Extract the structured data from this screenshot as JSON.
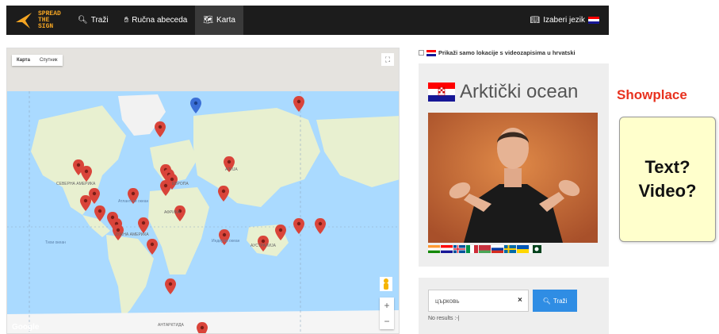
{
  "navbar": {
    "logo_text": [
      "SPREAD",
      "THE",
      "SIGN"
    ],
    "items": [
      {
        "label": "Traži",
        "icon": "search-icon"
      },
      {
        "label": "Ručna abeceda",
        "icon": "hand-icon"
      },
      {
        "label": "Karta",
        "icon": "map-icon",
        "active": true
      }
    ],
    "language": {
      "label": "Izaberi jezik",
      "icon": "book-icon"
    }
  },
  "map": {
    "type_options": [
      "Карта",
      "Спутник"
    ],
    "selected_type": "Карта",
    "region_labels": [
      "СЕВЕРНА АМЕРИКА",
      "АЗИЈА",
      "ЕВРОПА",
      "АФРИКА",
      "ЈУЖНА АМЕРИКА",
      "АУСТРАЛИЈА",
      "АНТАРКТИДА",
      "Tихи океан",
      "Индијски океан",
      "Атлантски океан"
    ],
    "google_label": "Google",
    "zoom_in": "+",
    "zoom_out": "−"
  },
  "filter": {
    "label": "Prikaži samo lokacije s videozapisima u hrvatski"
  },
  "location": {
    "title": "Arktički ocean",
    "flag": "croatia"
  },
  "language_flags": [
    "india",
    "croatia",
    "iceland",
    "italy",
    "belarus",
    "russia",
    "sweden",
    "ukraine",
    "pakistan"
  ],
  "search": {
    "value": "църковь",
    "button_label": "Traži",
    "clear_icon": "×",
    "results_text": "No results :-|"
  },
  "annotation": {
    "heading": "Showplace",
    "card_text": "Text?\nVideo?"
  },
  "colors": {
    "navbar": "#1c1c1c",
    "accent_orange": "#f5a623",
    "ocean": "#aadaff",
    "land": "#e8f0d0",
    "pin_red": "#d9443a",
    "pin_blue": "#3b6fd6",
    "search_button": "#2f8de4",
    "showplace_red": "#e8321f",
    "note_yellow": "#ffffcc"
  }
}
